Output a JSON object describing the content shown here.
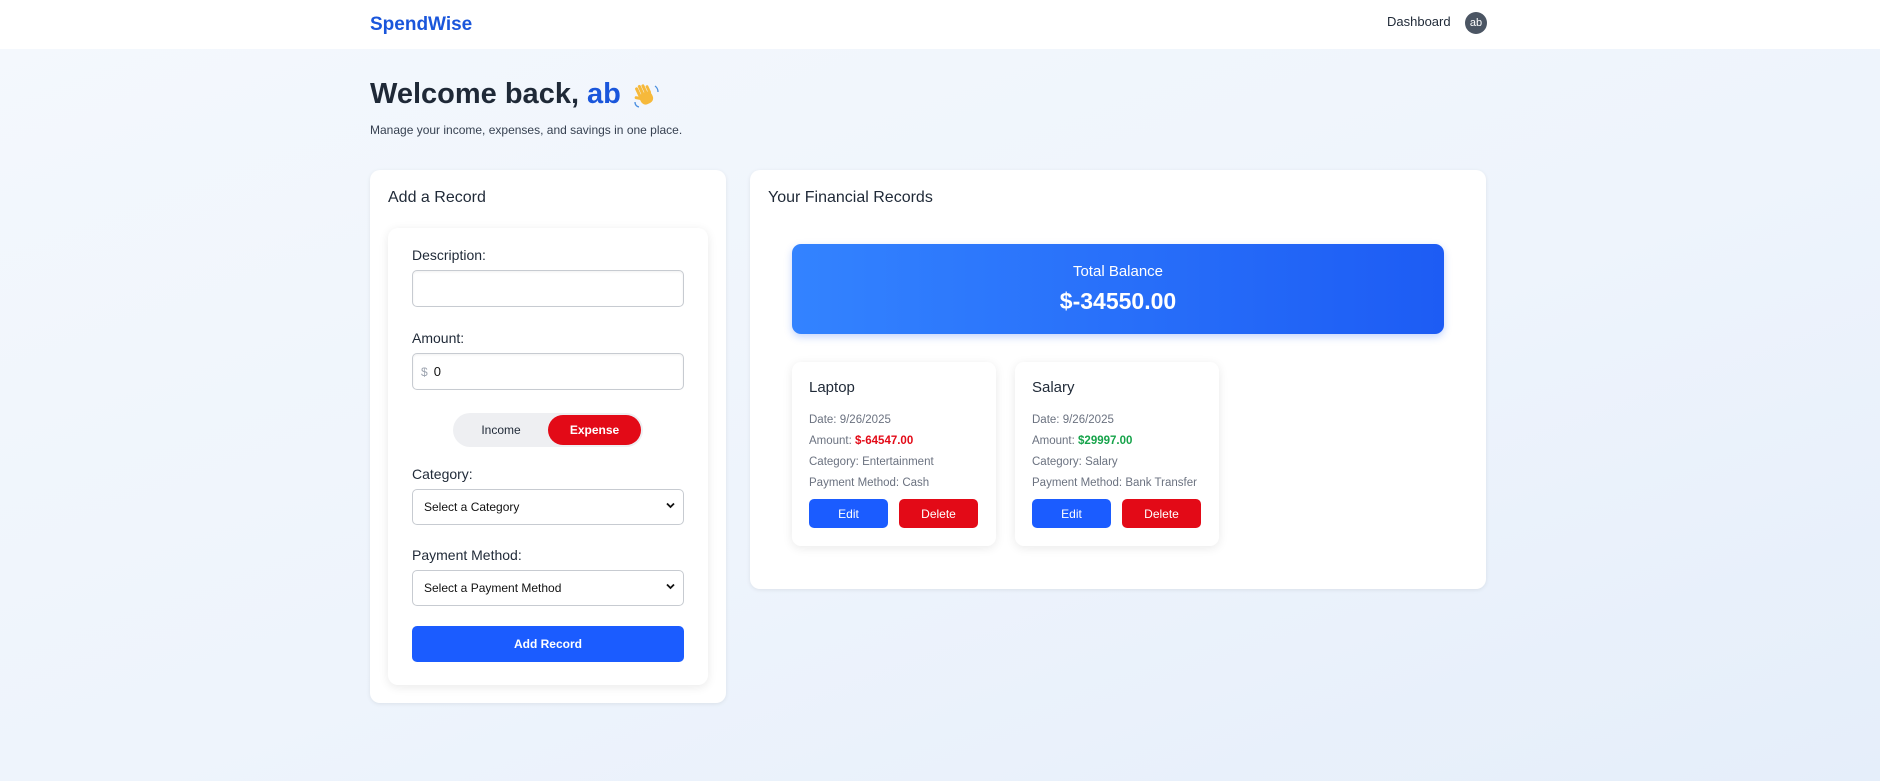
{
  "app": {
    "brand": "SpendWise",
    "nav_link": "Dashboard",
    "avatar_initials": "ab"
  },
  "welcome": {
    "prefix": "Welcome back,",
    "username": "ab",
    "emoji_icon": "waving-hand-icon",
    "subtitle": "Manage your income, expenses, and savings in one place."
  },
  "add_record": {
    "title": "Add a Record",
    "description_label": "Description:",
    "description_value": "",
    "amount_label": "Amount:",
    "currency_symbol": "$",
    "amount_value": "0",
    "toggle": {
      "income_label": "Income",
      "expense_label": "Expense",
      "selected": "Expense"
    },
    "category_label": "Category:",
    "category_selected": "Select a Category",
    "payment_label": "Payment Method:",
    "payment_selected": "Select a Payment Method",
    "submit_label": "Add Record"
  },
  "records": {
    "title": "Your Financial Records",
    "balance_label": "Total Balance",
    "balance_value": "$-34550.00",
    "items": [
      {
        "title": "Laptop",
        "date_label": "Date:",
        "date": "9/26/2025",
        "amount_label": "Amount:",
        "amount": "$-64547.00",
        "amount_type": "expense",
        "category_label": "Category:",
        "category": "Entertainment",
        "payment_label": "Payment Method:",
        "payment": "Cash",
        "edit_label": "Edit",
        "delete_label": "Delete"
      },
      {
        "title": "Salary",
        "date_label": "Date:",
        "date": "9/26/2025",
        "amount_label": "Amount:",
        "amount": "$29997.00",
        "amount_type": "income",
        "category_label": "Category:",
        "category": "Salary",
        "payment_label": "Payment Method:",
        "payment": "Bank Transfer",
        "edit_label": "Edit",
        "delete_label": "Delete"
      }
    ]
  },
  "colors": {
    "brand": "#1a56db",
    "primary_button": "#1b5cff",
    "danger": "#e30a17",
    "positive": "#16a34a"
  }
}
